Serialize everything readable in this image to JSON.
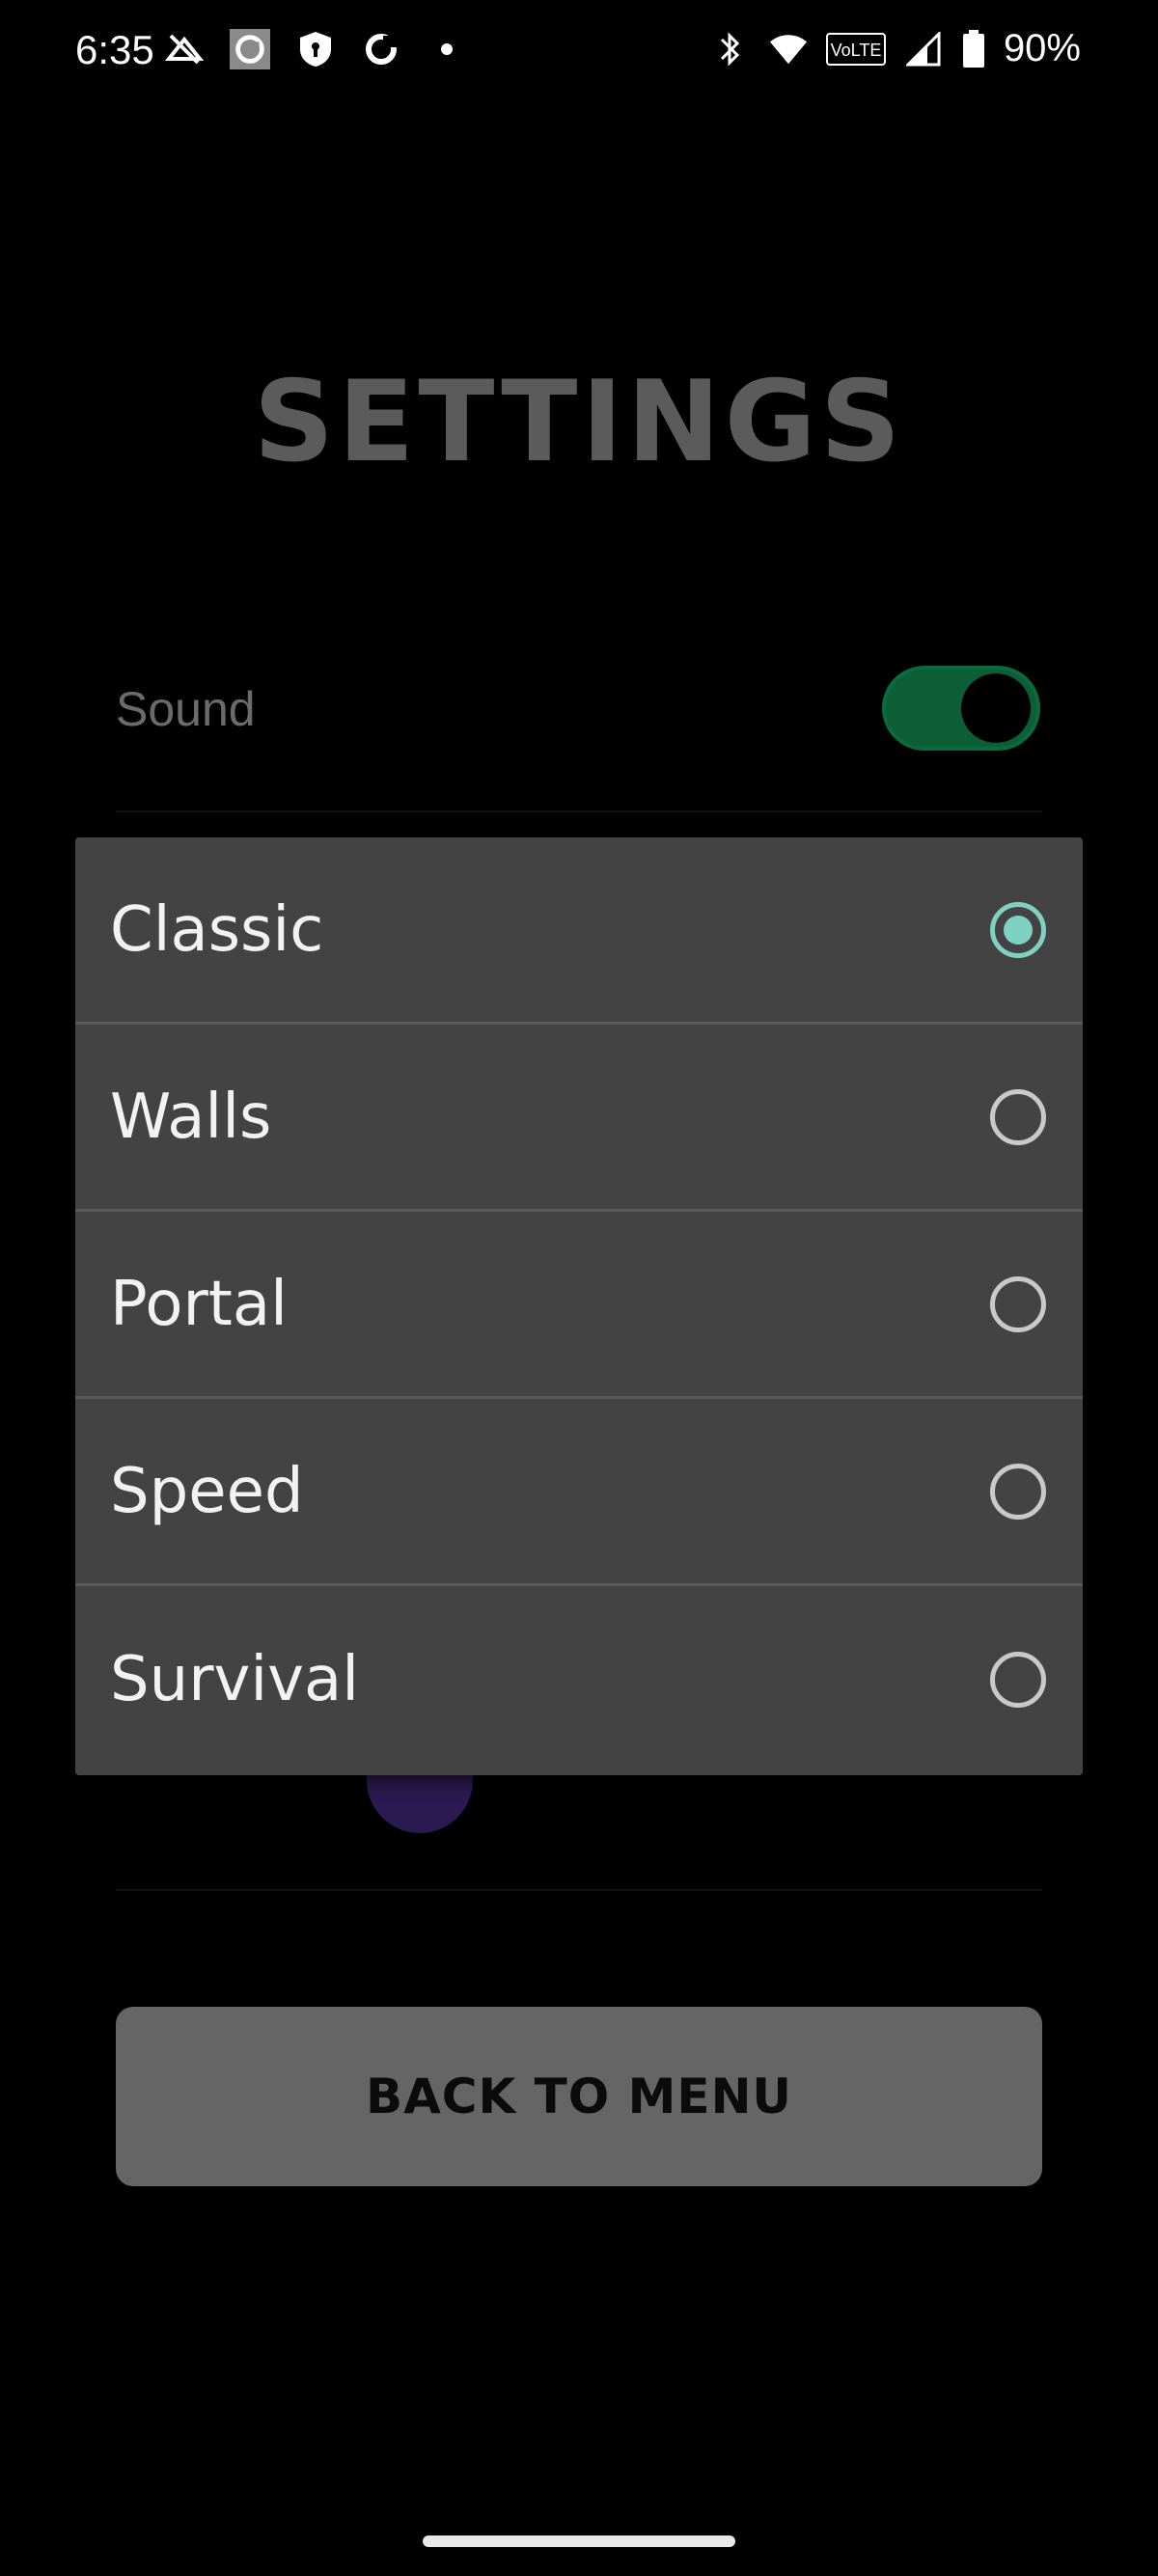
{
  "status_bar": {
    "time": "6:35",
    "battery_percent": "90%",
    "icons_left": [
      "signal-off-icon",
      "app-badge-icon",
      "shield-icon",
      "sync-icon",
      "dot-icon"
    ],
    "icons_right": [
      "bluetooth-icon",
      "wifi-icon",
      "volte-icon",
      "cell-signal-icon",
      "battery-icon"
    ],
    "volte_text": "VoLTE"
  },
  "settings": {
    "title": "SETTINGS",
    "sound_label": "Sound",
    "sound_enabled": true,
    "back_label": "BACK TO MENU"
  },
  "dropdown": {
    "options": [
      {
        "label": "Classic",
        "selected": true
      },
      {
        "label": "Walls",
        "selected": false
      },
      {
        "label": "Portal",
        "selected": false
      },
      {
        "label": "Speed",
        "selected": false
      },
      {
        "label": "Survival",
        "selected": false
      }
    ]
  },
  "colors": {
    "toggle_on": "#0b5e36",
    "radio_selected": "#7fd1c4",
    "menu_bg": "#434343"
  }
}
